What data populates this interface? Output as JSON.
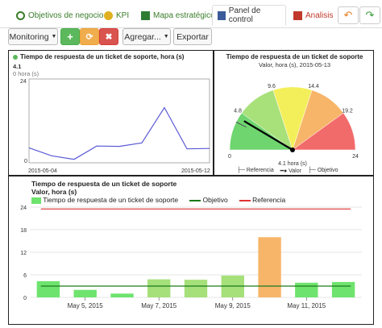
{
  "tabs": [
    {
      "label": "Objetivos de negocio",
      "icon": "goals-icon"
    },
    {
      "label": "KPI",
      "icon": "kpi-icon"
    },
    {
      "label": "Mapa estratégico",
      "icon": "map-icon"
    },
    {
      "label": "Panel de control",
      "icon": "dashboard-icon"
    },
    {
      "label": "Analisis",
      "icon": "analysis-icon"
    }
  ],
  "nav": {
    "undo_icon": "undo-icon",
    "redo_icon": "redo-icon"
  },
  "toolbar": {
    "monitoring": "Monitoring",
    "add_icon": "+",
    "edit_icon": "⟳",
    "delete_icon": "✖",
    "agregar": "Agregar...",
    "exportar": "Exportar"
  },
  "line_panel": {
    "title": "Tiempo de respuesta de un ticket de soporte, hora (s)",
    "value": "4.1",
    "sub": "0 hora (s)",
    "ymax": "24",
    "ymin": "0",
    "date_start": "2015-05-04",
    "date_end": "2015-05-12"
  },
  "gauge_panel": {
    "title": "Tiempo de respuesta de un ticket de soporte",
    "subtitle": "Valor, hora (s), 2015-05-13",
    "scale": [
      "0",
      "4.8",
      "9.6",
      "14.4",
      "19.2",
      "24"
    ],
    "value_text": "4.1 hora (s)",
    "legend": [
      "Referencia",
      "Valor",
      "Objetivo"
    ]
  },
  "bar_panel": {
    "title": "Tiempo de respuesta de un ticket de soporte",
    "subtitle": "Valor, hora (s)",
    "legend": [
      "Tiempo de respuesta de un ticket de soporte",
      "Objetivo",
      "Referencia"
    ],
    "x_ticks": [
      "May 5, 2015",
      "May 7, 2015",
      "May 9, 2015",
      "May 11, 2015"
    ]
  },
  "colors": {
    "accent": "#5cb85c",
    "danger": "#d9534f",
    "warning": "#f0ad4e",
    "line": "#5a5ad6"
  },
  "chart_data": [
    {
      "type": "line",
      "title": "Tiempo de respuesta de un ticket de soporte, hora (s)",
      "x": [
        "2015-05-04",
        "2015-05-05",
        "2015-05-06",
        "2015-05-07",
        "2015-05-08",
        "2015-05-09",
        "2015-05-10",
        "2015-05-11",
        "2015-05-12"
      ],
      "values": [
        4.3,
        2.0,
        1.0,
        4.8,
        4.7,
        5.7,
        15.8,
        4.0,
        4.1
      ],
      "ylim": [
        0,
        24
      ]
    },
    {
      "type": "gauge",
      "value": 4.1,
      "range": [
        0,
        24
      ],
      "bands": [
        {
          "from": 0,
          "to": 4.8,
          "color": "#6fd56f"
        },
        {
          "from": 4.8,
          "to": 9.6,
          "color": "#a8e07a"
        },
        {
          "from": 9.6,
          "to": 14.4,
          "color": "#f3ef5a"
        },
        {
          "from": 14.4,
          "to": 19.2,
          "color": "#f7b56a"
        },
        {
          "from": 19.2,
          "to": 24,
          "color": "#f26b6b"
        }
      ],
      "target": 3.5
    },
    {
      "type": "bar",
      "ylabel": "Valor, hora (s)",
      "ylim": [
        0,
        24
      ],
      "y_ticks": [
        0,
        6,
        12,
        18,
        24
      ],
      "values": [
        4.3,
        2.0,
        1.0,
        4.8,
        4.7,
        5.8,
        16.0,
        3.9,
        4.1
      ],
      "bar_colors": [
        "#6ee36e",
        "#6ee36e",
        "#6ee36e",
        "#a6e07a",
        "#a6e07a",
        "#a6e07a",
        "#f7b56a",
        "#6ee36e",
        "#6ee36e"
      ],
      "objetivo": 3.0,
      "referencia": 23.5
    }
  ]
}
